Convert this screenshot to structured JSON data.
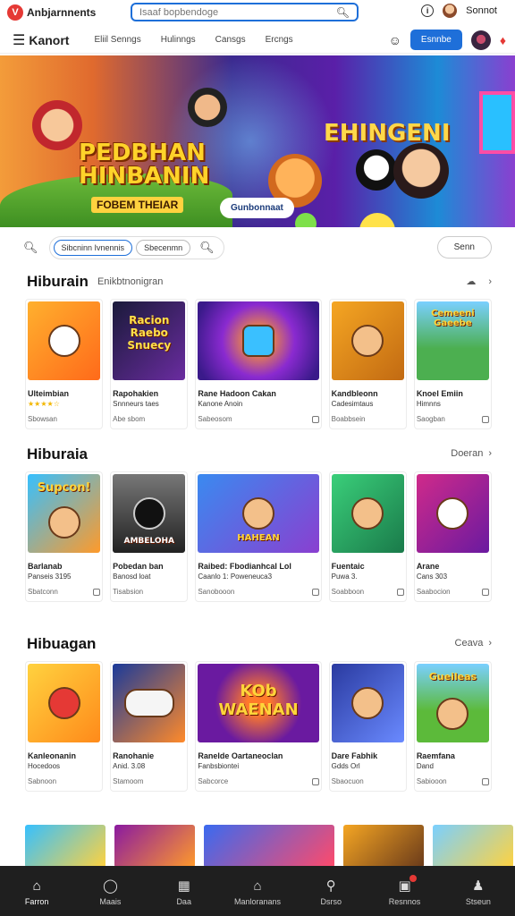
{
  "topbar": {
    "brand": "Anbjarnnents",
    "search_placeholder": "Isaaf bopbendoge",
    "info_icon": "i",
    "user": "Sonnot"
  },
  "nav": {
    "title": "Kanort",
    "links": [
      "Eliil Senngs",
      "Hulinngs",
      "Cansgs",
      "Ercngs"
    ],
    "cta": "Esnnbe"
  },
  "hero": {
    "title_left_1": "PEDBHAN",
    "title_left_2": "HINBANIN",
    "subtitle_left": "FOBEM THEIAR",
    "title_right": "EHINGENI",
    "cta": "Gunbonnaat"
  },
  "filters": {
    "chips": [
      "Sibcninn Ivnennis",
      "Sbecenmn"
    ],
    "sort": "Senn"
  },
  "sections": [
    {
      "title": "Hiburain",
      "subtitle": "Enikbtnonigran",
      "action": "",
      "cards": [
        {
          "name": "Ulteimbian",
          "sub": "★★★★☆",
          "meta": "Sbowsan"
        },
        {
          "name": "Rapohakien",
          "sub": "Snnneurs taes",
          "meta": "Abe sbom"
        },
        {
          "name": "Rane Hadoon Cakan",
          "sub": "Kanone Anoin",
          "meta": "Sabeosom"
        },
        {
          "name": "Kandbleonn",
          "sub": "Cadesimtaus",
          "meta": "Boabbsein"
        },
        {
          "name": "Knoel Emiin",
          "sub": "Himnns",
          "meta": "Saogban"
        }
      ]
    },
    {
      "title": "Hiburaia",
      "subtitle": "",
      "action": "Doeran",
      "cards": [
        {
          "name": "Barlanab",
          "sub": "Panseis 3195",
          "meta": "Sbatconn"
        },
        {
          "name": "Pobedan ban",
          "sub": "Banosd loat",
          "meta": "Tisabsion"
        },
        {
          "name": "Raibed: Fbodianhcal Lol",
          "sub": "Caanlo 1: Poweneuca3",
          "meta": "Sanobooon"
        },
        {
          "name": "Fuentaic",
          "sub": "Puwa 3.",
          "meta": "Soabboon"
        },
        {
          "name": "Arane",
          "sub": "Cans 303",
          "meta": "Saabocion"
        }
      ]
    },
    {
      "title": "Hibuagan",
      "subtitle": "",
      "action": "Ceava",
      "cards": [
        {
          "name": "Kanleonanin",
          "sub": "Hocedoos",
          "meta": "Sabnoon"
        },
        {
          "name": "Ranohanie",
          "sub": "Anid. 3.08",
          "meta": "Stamoom"
        },
        {
          "name": "Ranelde Oartaneoclan",
          "sub": "Fanbsbiontei",
          "meta": "Sabcorce"
        },
        {
          "name": "Dare Fabhik",
          "sub": "Gdds Orl",
          "meta": "Sbaocuon"
        },
        {
          "name": "Raemfana",
          "sub": "Dand",
          "meta": "Sabiooon"
        }
      ]
    }
  ],
  "thumb_words": {
    "s1": [
      "",
      "Racion Raebo Snuecy",
      "",
      "",
      "Cemeeni Gaeebe"
    ],
    "s2": [
      "Supcon!",
      "AMBELOHA",
      "HAHEAN",
      "",
      ""
    ],
    "s3": [
      "",
      "",
      "KOb WAENAN",
      "",
      "Gueileas"
    ]
  },
  "bottom_nav": [
    {
      "label": "Farron",
      "icon": "home-icon"
    },
    {
      "label": "Maais",
      "icon": "chat-icon"
    },
    {
      "label": "Daa",
      "icon": "grid-icon"
    },
    {
      "label": "Manloranans",
      "icon": "store-icon"
    },
    {
      "label": "Dsrso",
      "icon": "search-icon"
    },
    {
      "label": "Resnnos",
      "icon": "notifications-icon"
    },
    {
      "label": "Stseun",
      "icon": "profile-icon"
    }
  ],
  "colors": {
    "accent": "#1e6fd9",
    "brand": "#e53935",
    "bottom_nav_bg": "#1f1f1f",
    "star": "#f2b600"
  }
}
